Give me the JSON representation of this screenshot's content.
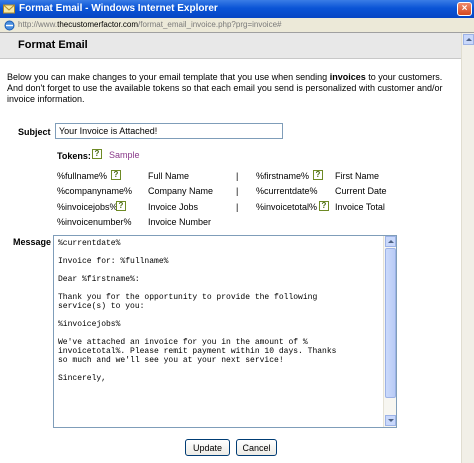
{
  "window": {
    "title": "Format Email - Windows Internet Explorer",
    "close_glyph": "×"
  },
  "address": {
    "scheme": "http://www.",
    "domain": "thecustomerfactor.com",
    "path": "/format_email_invoice.php?prg=invoice#"
  },
  "page": {
    "heading": "Format Email",
    "intro_before": "Below you can make changes to your email template that you use when sending ",
    "intro_bold": "invoices",
    "intro_after": " to your customers. And don't forget to use the available tokens so that each email you send is personalized with customer and/or invoice information."
  },
  "subject": {
    "label": "Subject",
    "value": "Your Invoice is Attached!"
  },
  "tokens": {
    "label": "Tokens:",
    "help_glyph": "?",
    "sample_link": "Sample",
    "separator": "|",
    "left": [
      {
        "token": "%fullname%",
        "desc": "Full Name"
      },
      {
        "token": "%companyname%",
        "desc": "Company Name"
      },
      {
        "token": "%invoicejobs%",
        "desc": "Invoice Jobs"
      },
      {
        "token": "%invoicenumber%",
        "desc": "Invoice Number"
      }
    ],
    "right": [
      {
        "token": "%firstname%",
        "desc": "First Name"
      },
      {
        "token": "%currentdate%",
        "desc": "Current Date"
      },
      {
        "token": "%invoicetotal%",
        "desc": "Invoice Total"
      }
    ]
  },
  "message": {
    "label": "Message",
    "body": "%currentdate%\n\nInvoice for: %fullname%\n\nDear %firstname%:\n\nThank you for the opportunity to provide the following\nservice(s) to you:\n\n%invoicejobs%\n\nWe've attached an invoice for you in the amount of %\ninvoicetotal%. Please remit payment within 10 days. Thanks\nso much and we'll see you at your next service!\n\nSincerely,"
  },
  "buttons": {
    "update": "Update",
    "cancel": "Cancel"
  },
  "colors": {
    "titlebar": "#0a54d6",
    "link": "#8a3a8a",
    "input_border": "#7f9db9"
  }
}
